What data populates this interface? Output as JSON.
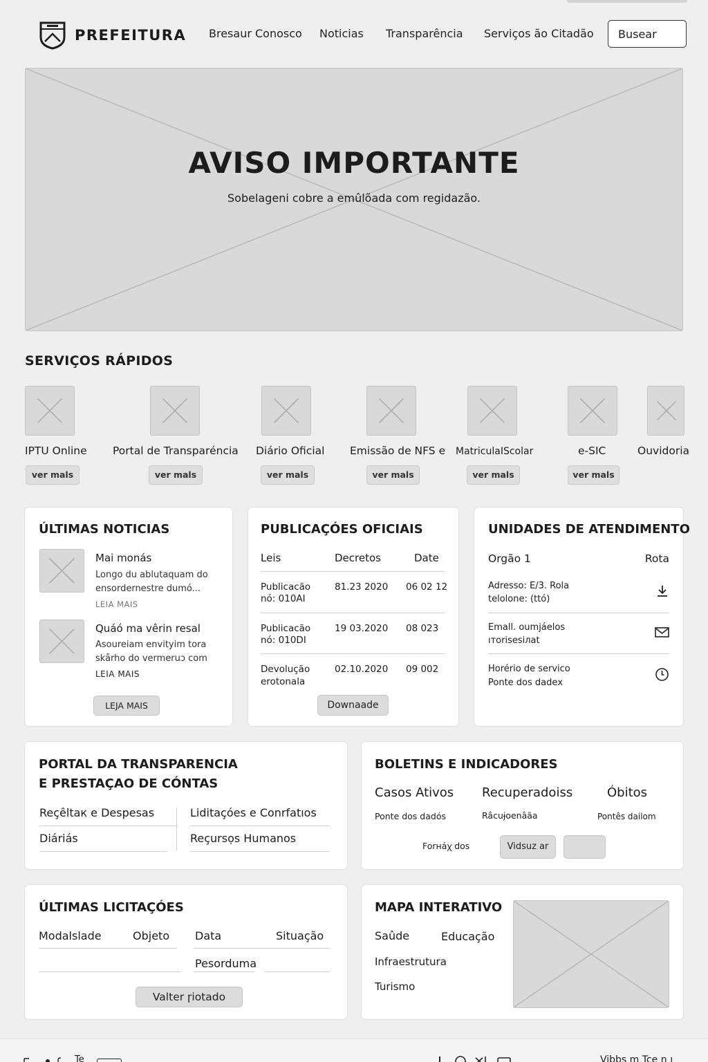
{
  "header": {
    "logo_text": "PREFEITURA",
    "nav": [
      "Bresaur Conosco",
      "Noticias",
      "Transparência",
      "Serviços ão Citadão"
    ],
    "search_label": "Busear"
  },
  "hero": {
    "title": "AVISO IMPORTANTE",
    "subtitle": "Sobelageni cobre a emûlõada com regidazão."
  },
  "quick_services": {
    "title": "SERVIÇOS RÁPIDOS",
    "items": [
      {
        "label": "IPTU Online",
        "button": "ver mals"
      },
      {
        "label": "Portal de Transparéncia",
        "button": "ver mals"
      },
      {
        "label": "Diário Oficial",
        "button": "ver mals"
      },
      {
        "label": "Emissão de NFS e",
        "button": "ver mals"
      },
      {
        "label": "MatriculaIScolar",
        "button": "ver mals"
      },
      {
        "label": "e-SIC",
        "button": "ver mals"
      },
      {
        "label": "Ouvidoria",
        "button": ""
      }
    ]
  },
  "news": {
    "title": "ÚLTIMAS NOTICIAS",
    "items": [
      {
        "headline": "Mai monás",
        "line1": "Longo du ablutaquam do",
        "line2": "ensordernestre dumó...",
        "more": "LEIA MAIS"
      },
      {
        "headline": "Quáó ma vêrin resal",
        "line1": "Asoureiam envityim tora",
        "line2": "skârho do vermeruɔ com",
        "more": "LEIA MAIS"
      }
    ],
    "button": "LEJA MAIS"
  },
  "publications": {
    "title": "PUBLICAÇÓES OFICIAIS",
    "columns": [
      "Leis",
      "Decretos",
      "Date"
    ],
    "rows": [
      {
        "name1": "Publicacão",
        "name2": "nó: 010AI",
        "decree": "81.23 2020",
        "date": "06 02 12"
      },
      {
        "name1": "Publicacão",
        "name2": "nó: 010DI",
        "decree": "19 03.2020",
        "date": "08 023"
      },
      {
        "name1": "Devolução",
        "name2": "erotonala",
        "decree": "02.10.2020",
        "date": "09 002"
      }
    ],
    "button": "Downaade"
  },
  "units": {
    "title": "UNIDADES DE ATENDIMENTO",
    "col1": "Orgão 1",
    "col2": "Rota",
    "rows": [
      {
        "line1": "Adresso: E/3. Rola",
        "line2": "telolone: (ttó)",
        "icon": "download-icon"
      },
      {
        "line1": "Emall. oumjáelos",
        "line2": "ıтorisesiлat",
        "icon": "mail-icon"
      },
      {
        "line1": "Horério de servico",
        "line2": "Ponte dos dadeх",
        "icon": "clock-icon"
      }
    ]
  },
  "transparency": {
    "title1": "PORTAL DA TRANSPARENCIA",
    "title2": "E PRESTAÇAO DE CÓNTAS",
    "links": [
      "Reçêltaк e Despesas",
      "Liditaçóes e Conrfatıos",
      "Diáriás",
      "Reçursọs Humanos"
    ]
  },
  "bulletins": {
    "title": "BOLETINS E INDICADORES",
    "cols": [
      {
        "label": "Casos Ativos",
        "sub": "Ponte dos dadós"
      },
      {
        "label": "Recuperadoiss",
        "sub": "Râcuɉoenâãa"
      },
      {
        "label": "Óbitos",
        "sub": "Pontês dailom"
      }
    ],
    "source": "Forнáꭓ dos",
    "button": "Vidsuz ar"
  },
  "tenders": {
    "title": "ÚLTIMAS LICITAÇÓES",
    "columns": [
      "Modalslade",
      "Objeto",
      "Data",
      "Situação"
    ],
    "cell": "Pesorduma",
    "button": "Valter ɼiotado"
  },
  "map": {
    "title": "MAPA INTERATIVO",
    "layers": [
      "Saûde",
      "Educação",
      "Infraestrutura",
      "Turismo"
    ]
  },
  "footer": {
    "left": "Te",
    "right": "Vibbs m Tce ɲ ı"
  }
}
